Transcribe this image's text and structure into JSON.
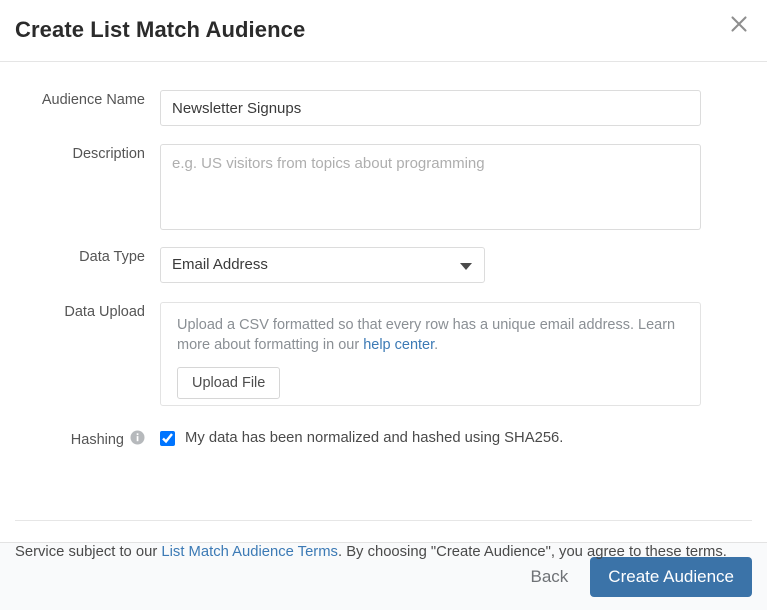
{
  "dialog": {
    "title": "Create List Match Audience",
    "close_icon": "close-icon"
  },
  "form": {
    "audience_name": {
      "label": "Audience Name",
      "value": "Newsletter Signups",
      "placeholder": ""
    },
    "description": {
      "label": "Description",
      "value": "",
      "placeholder": "e.g. US visitors from topics about programming"
    },
    "data_type": {
      "label": "Data Type",
      "selected": "Email Address",
      "options": [
        "Email Address"
      ],
      "caret_icon": "chevron-down-icon"
    },
    "data_upload": {
      "label": "Data Upload",
      "description_line1": "Upload a CSV formatted so that every row has a unique email address.",
      "description_line2_prefix": "Learn more about formatting in our ",
      "help_link_text": "help center",
      "description_line2_suffix": ".",
      "upload_button": "Upload File"
    },
    "hashing": {
      "label": "Hashing",
      "info_icon": "info-icon",
      "checked": true,
      "checkbox_text": "My data has been normalized and hashed using SHA256."
    }
  },
  "terms": {
    "prefix": "Service subject to our ",
    "link_text": "List Match Audience Terms",
    "suffix": ". By choosing \"Create Audience\", you agree to these terms."
  },
  "footer": {
    "back_label": "Back",
    "create_label": "Create Audience"
  },
  "colors": {
    "primary": "#3b73a8",
    "link": "#3c7ab5",
    "muted_text": "#8a8f94",
    "border": "#dcdcdc"
  }
}
